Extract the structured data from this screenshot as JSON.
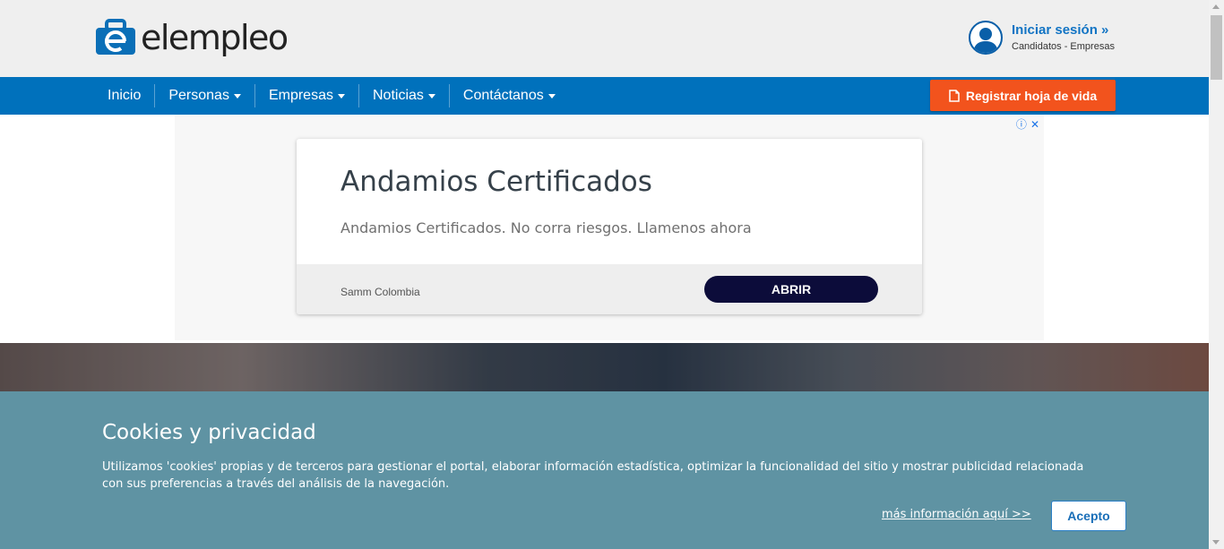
{
  "brand": {
    "name": "elempleo",
    "primary_color": "#0071bc",
    "accent_color": "#f2531d"
  },
  "login": {
    "title": "Iniciar sesión »",
    "subtitle": "Candidatos - Empresas"
  },
  "nav": {
    "items": [
      {
        "label": "Inicio",
        "dropdown": false
      },
      {
        "label": "Personas",
        "dropdown": true
      },
      {
        "label": "Empresas",
        "dropdown": true
      },
      {
        "label": "Noticias",
        "dropdown": true
      },
      {
        "label": "Contáctanos",
        "dropdown": true
      }
    ],
    "register_label": "Registrar hoja de vida"
  },
  "ad": {
    "title": "Andamios Certificados",
    "description": "Andamios Certificados. No corra riesgos. Llamenos ahora",
    "advertiser": "Samm Colombia",
    "cta": "ABRIR",
    "info_icon": "ⓘ",
    "close_icon": "✕"
  },
  "cookies": {
    "title": "Cookies y privacidad",
    "text": "Utilizamos 'cookies' propias y de terceros para gestionar el portal, elaborar información estadística, optimizar la funcionalidad del sitio y mostrar publicidad relacionada con sus preferencias a través del análisis de la navegación.",
    "more_link": "más información aquí >>",
    "accept_label": "Acepto"
  }
}
